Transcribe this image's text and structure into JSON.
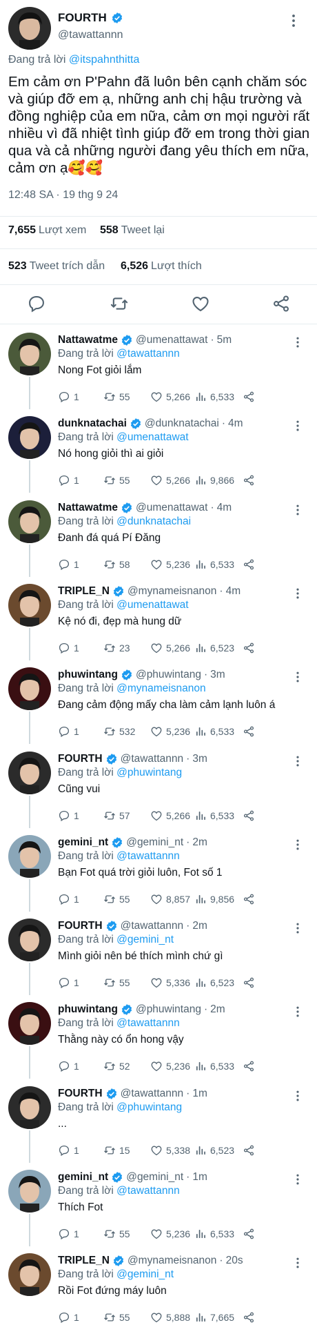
{
  "main_tweet": {
    "display_name": "FOURTH",
    "handle": "@tawattannn",
    "replying_prefix": "Đang trả lời",
    "replying_to": "@itspahnthitta",
    "text": "Em cảm ơn P'Pahn đã luôn bên cạnh chăm sóc và giúp đỡ em ạ, những anh chị hậu trường và đồng nghiệp của em nữa, cảm ơn mọi người rất nhiều vì đã nhiệt tình giúp đỡ em trong thời gian qua và cả những người đang yêu thích em nữa, cảm ơn ạ🥰🥰",
    "timestamp": "12:48 SA · 19 thg 9 24",
    "views_count": "7,655",
    "views_label": "Lượt xem",
    "retweets_count": "558",
    "retweets_label": "Tweet lại",
    "quotes_count": "523",
    "quotes_label": "Tweet trích dẫn",
    "likes_count": "6,526",
    "likes_label": "Lượt thích",
    "avatar_bg": "#2b2b2b"
  },
  "replies": [
    {
      "name": "Nattawatme",
      "handle": "@umenattawat",
      "time": "5m",
      "reply_to": "@tawattannn",
      "text": "Nong Fot giỏi lắm",
      "replies": "1",
      "retweets": "55",
      "likes": "5,266",
      "views": "6,533",
      "avatar_bg": "#4b5a3a"
    },
    {
      "name": "dunknatachai",
      "handle": "@dunknatachai",
      "time": "4m",
      "reply_to": "@umenattawat",
      "text": "Nó hong giỏi thì ai giỏi",
      "replies": "1",
      "retweets": "55",
      "likes": "5,266",
      "views": "9,866",
      "avatar_bg": "#1c1f3a"
    },
    {
      "name": "Nattawatme",
      "handle": "@umenattawat",
      "time": "4m",
      "reply_to": "@dunknatachai",
      "text": "Đanh đá quá Pí Đăng",
      "replies": "1",
      "retweets": "58",
      "likes": "5,236",
      "views": "6,533",
      "avatar_bg": "#4b5a3a"
    },
    {
      "name": "TRIPLE_N",
      "handle": "@mynameisnanon",
      "time": "4m",
      "reply_to": "@umenattawat",
      "text": "Kệ nó đi, đẹp mà hung dữ",
      "replies": "1",
      "retweets": "23",
      "likes": "5,266",
      "views": "6,523",
      "avatar_bg": "#6b4a2e"
    },
    {
      "name": "phuwintang",
      "handle": "@phuwintang",
      "time": "3m",
      "reply_to": "@mynameisnanon",
      "text": "Đang cảm động mấy cha làm cảm lạnh luôn á",
      "replies": "1",
      "retweets": "532",
      "likes": "5,236",
      "views": "6,533",
      "avatar_bg": "#3a0f12"
    },
    {
      "name": "FOURTH",
      "handle": "@tawattannn",
      "time": "3m",
      "reply_to": "@phuwintang",
      "text": "Cũng vui",
      "replies": "1",
      "retweets": "57",
      "likes": "5,266",
      "views": "6,533",
      "avatar_bg": "#2b2b2b"
    },
    {
      "name": "gemini_nt",
      "handle": "@gemini_nt",
      "time": "2m",
      "reply_to": "@tawattannn",
      "text": "Bạn Fot quá trời giỏi luôn, Fot số 1",
      "replies": "1",
      "retweets": "55",
      "likes": "8,857",
      "views": "9,856",
      "avatar_bg": "#8aa6b8"
    },
    {
      "name": "FOURTH",
      "handle": "@tawattannn",
      "time": "2m",
      "reply_to": "@gemini_nt",
      "text": "Mình giỏi nên bé thích mình chứ gì",
      "replies": "1",
      "retweets": "55",
      "likes": "5,336",
      "views": "6,523",
      "avatar_bg": "#2b2b2b"
    },
    {
      "name": "phuwintang",
      "handle": "@phuwintang",
      "time": "2m",
      "reply_to": "@tawattannn",
      "text": "Thằng này có ổn hong vậy",
      "replies": "1",
      "retweets": "52",
      "likes": "5,236",
      "views": "6,533",
      "avatar_bg": "#3a0f12"
    },
    {
      "name": "FOURTH",
      "handle": "@tawattannn",
      "time": "1m",
      "reply_to": "@phuwintang",
      "text": "...",
      "replies": "1",
      "retweets": "15",
      "likes": "5,338",
      "views": "6,523",
      "avatar_bg": "#2b2b2b"
    },
    {
      "name": "gemini_nt",
      "handle": "@gemini_nt",
      "time": "1m",
      "reply_to": "@tawattannn",
      "text": "Thích Fot",
      "replies": "1",
      "retweets": "55",
      "likes": "5,236",
      "views": "6,533",
      "avatar_bg": "#8aa6b8"
    },
    {
      "name": "TRIPLE_N",
      "handle": "@mynameisnanon",
      "time": "20s",
      "reply_to": "@gemini_nt",
      "text": "Rồi Fot đứng máy luôn",
      "replies": "1",
      "retweets": "55",
      "likes": "5,888",
      "views": "7,665",
      "avatar_bg": "#6b4a2e"
    }
  ],
  "replying_prefix": "Đang trả lời",
  "colors": {
    "accent": "#1d9bf0",
    "muted": "#536471",
    "text": "#0f1419",
    "verified": "#1d9bf0"
  },
  "icons": [
    "verified-badge-icon",
    "more-icon",
    "reply-icon",
    "retweet-icon",
    "like-icon",
    "share-icon",
    "views-icon"
  ]
}
